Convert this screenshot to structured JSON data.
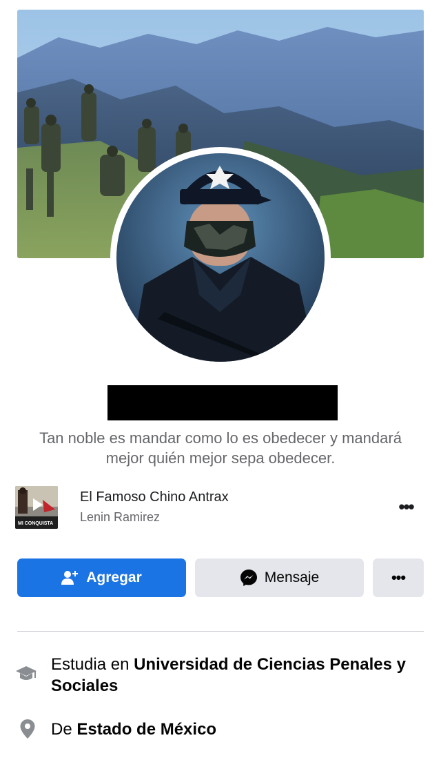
{
  "profile": {
    "bio": "Tan noble es mandar como lo es obedecer y mandará mejor quién mejor sepa obedecer."
  },
  "featured": {
    "title": "El Famoso Chino Antrax",
    "subtitle": "Lenin Ramirez",
    "thumb_text": "MI CONQUISTA",
    "more_label": "•••"
  },
  "actions": {
    "add_label": "Agregar",
    "message_label": "Mensaje",
    "more_label": "•••"
  },
  "about": {
    "education_prefix": "Estudia en ",
    "education_school": "Universidad de Ciencias Penales y Sociales",
    "location_prefix": "De ",
    "location_place": "Estado de México"
  },
  "colors": {
    "primary": "#1b74e4",
    "secondary_bg": "#e4e6eb",
    "muted_text": "#65676b",
    "redaction": "#000000"
  },
  "icons": {
    "add_friend": "person-plus-icon",
    "messenger": "messenger-icon",
    "education": "graduation-cap-icon",
    "location": "map-pin-icon"
  }
}
